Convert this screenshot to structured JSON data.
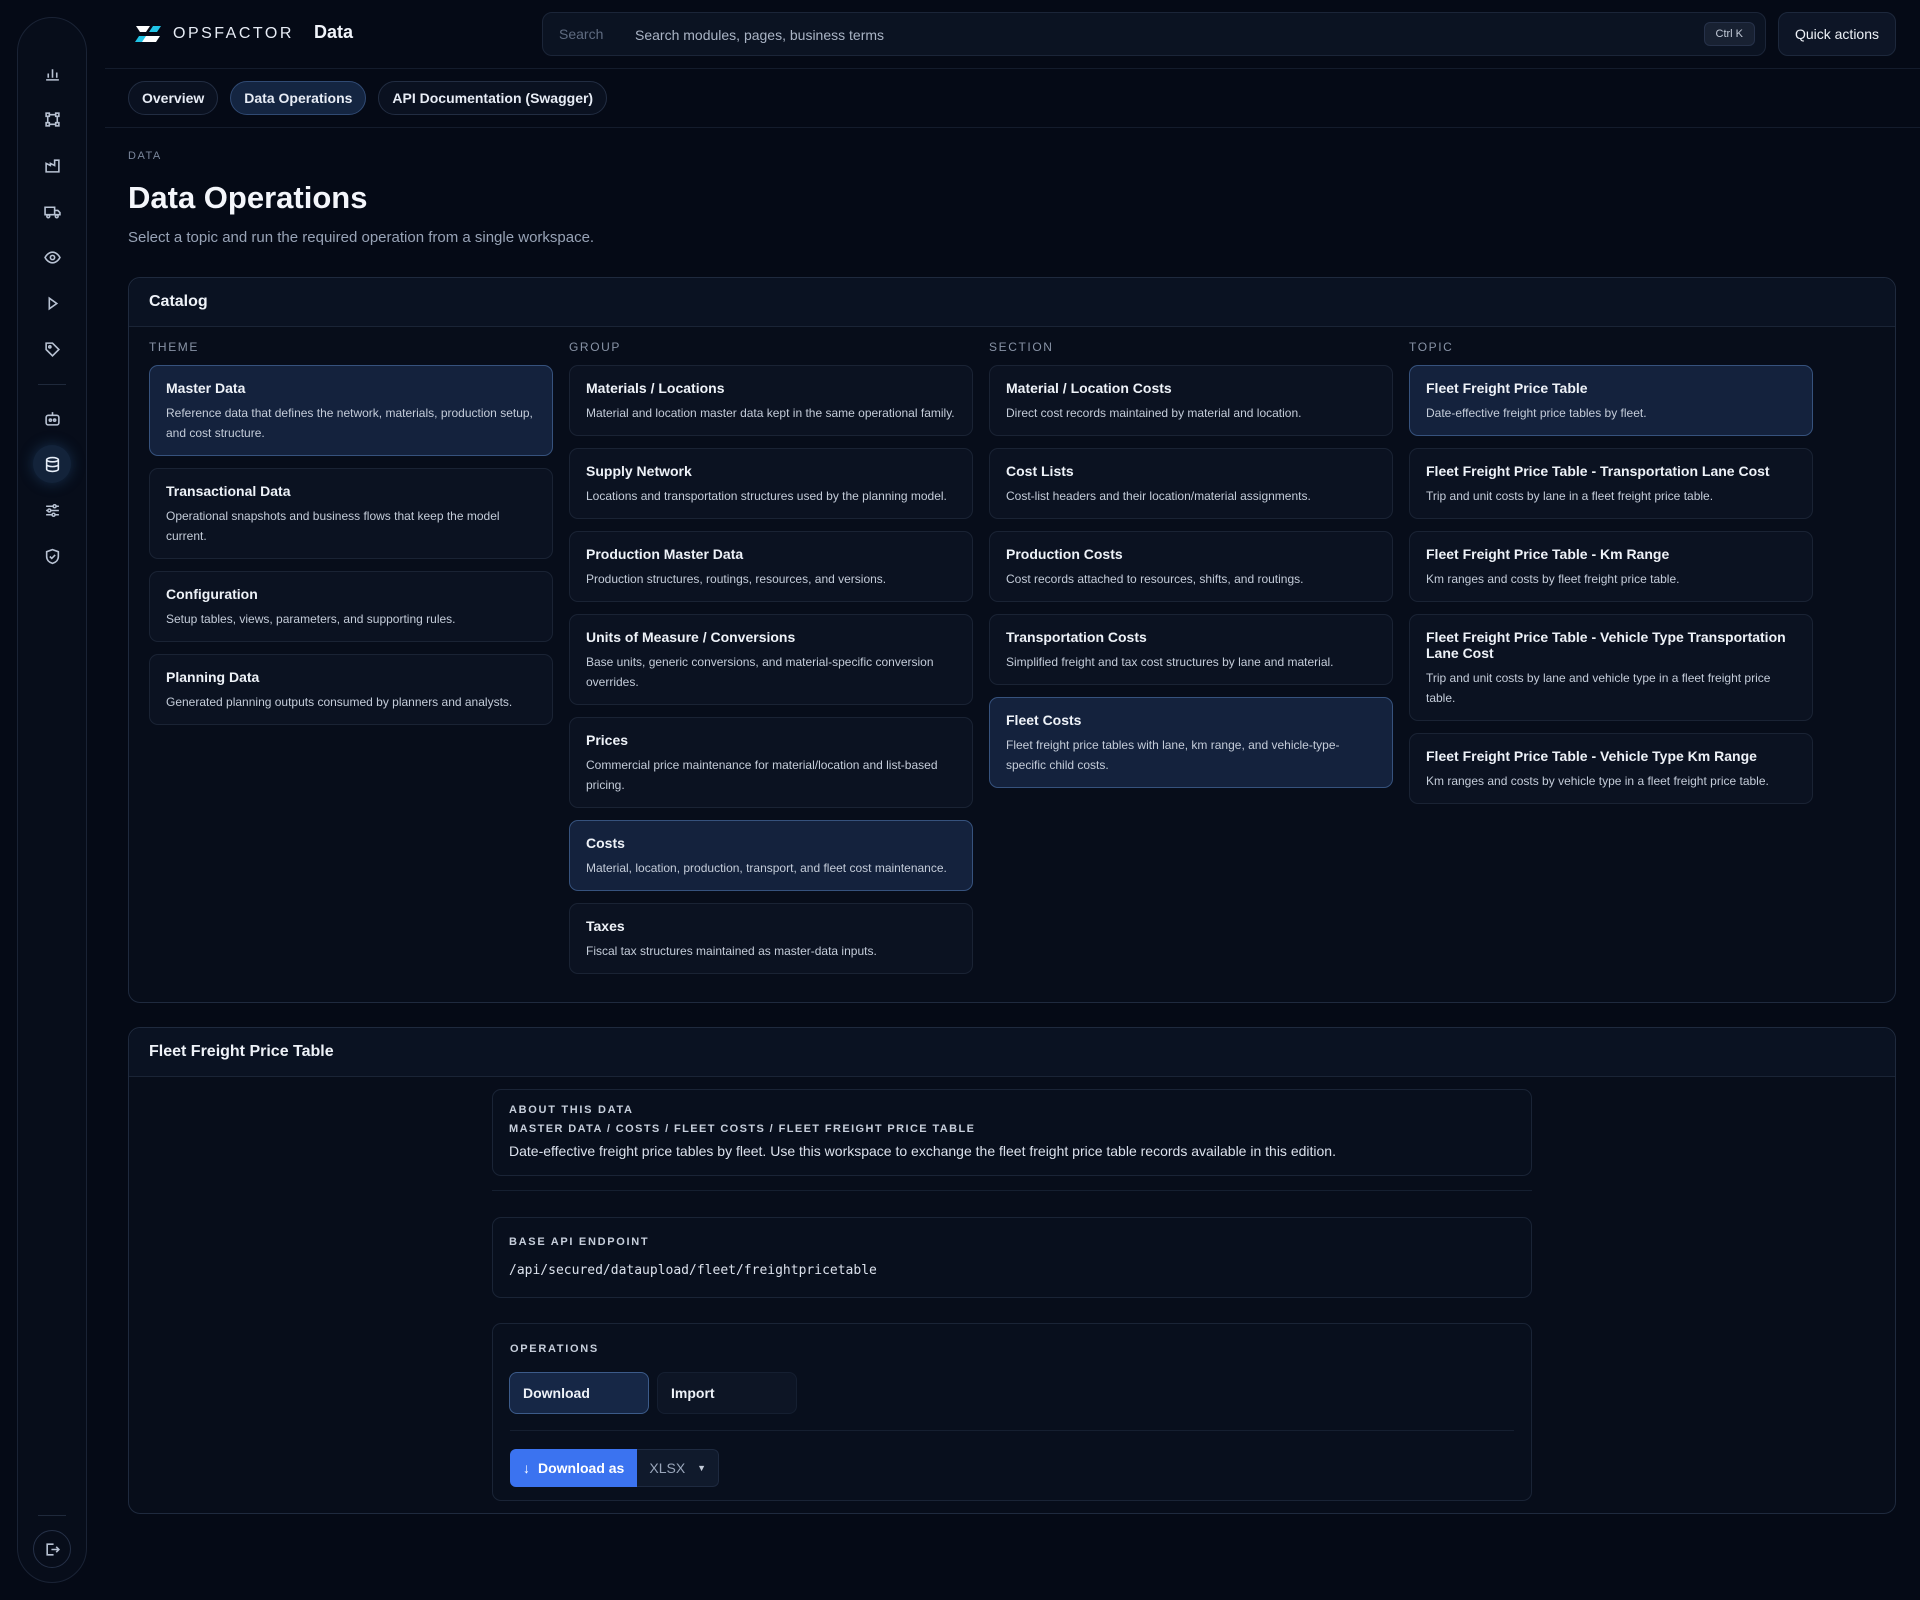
{
  "app": {
    "logo_text": "OPSFACTOR",
    "section": "Data",
    "search_label": "Search",
    "search_placeholder": "Search modules, pages, business terms",
    "search_shortcut": "Ctrl K",
    "quick_actions": "Quick actions"
  },
  "sidebar": {
    "icons": [
      "bar-chart-icon",
      "network-icon",
      "factory-icon",
      "truck-icon",
      "eye-icon",
      "play-icon",
      "tag-icon",
      "robot-icon",
      "database-icon",
      "sliders-icon",
      "shield-icon"
    ],
    "active": "database-icon",
    "footer_icon": "logout-icon"
  },
  "tabs": [
    "Overview",
    "Data Operations",
    "API Documentation (Swagger)"
  ],
  "active_tab": "Data Operations",
  "header": {
    "eyebrow": "DATA",
    "title": "Data Operations",
    "subtitle": "Select a topic and run the required operation from a single workspace."
  },
  "catalog": {
    "title": "Catalog",
    "columns": [
      {
        "heading": "THEME",
        "items": [
          {
            "title": "Master Data",
            "desc": "Reference data that defines the network, materials, production setup, and cost structure.",
            "active": true
          },
          {
            "title": "Transactional Data",
            "desc": "Operational snapshots and business flows that keep the model current.",
            "active": false
          },
          {
            "title": "Configuration",
            "desc": "Setup tables, views, parameters, and supporting rules.",
            "active": false
          },
          {
            "title": "Planning Data",
            "desc": "Generated planning outputs consumed by planners and analysts.",
            "active": false
          }
        ]
      },
      {
        "heading": "GROUP",
        "items": [
          {
            "title": "Materials / Locations",
            "desc": "Material and location master data kept in the same operational family.",
            "active": false
          },
          {
            "title": "Supply Network",
            "desc": "Locations and transportation structures used by the planning model.",
            "active": false
          },
          {
            "title": "Production Master Data",
            "desc": "Production structures, routings, resources, and versions.",
            "active": false
          },
          {
            "title": "Units of Measure / Conversions",
            "desc": "Base units, generic conversions, and material-specific conversion overrides.",
            "active": false
          },
          {
            "title": "Prices",
            "desc": "Commercial price maintenance for material/location and list-based pricing.",
            "active": false
          },
          {
            "title": "Costs",
            "desc": "Material, location, production, transport, and fleet cost maintenance.",
            "active": true
          },
          {
            "title": "Taxes",
            "desc": "Fiscal tax structures maintained as master-data inputs.",
            "active": false
          }
        ]
      },
      {
        "heading": "SECTION",
        "items": [
          {
            "title": "Material / Location Costs",
            "desc": "Direct cost records maintained by material and location.",
            "active": false
          },
          {
            "title": "Cost Lists",
            "desc": "Cost-list headers and their location/material assignments.",
            "active": false
          },
          {
            "title": "Production Costs",
            "desc": "Cost records attached to resources, shifts, and routings.",
            "active": false
          },
          {
            "title": "Transportation Costs",
            "desc": "Simplified freight and tax cost structures by lane and material.",
            "active": false
          },
          {
            "title": "Fleet Costs",
            "desc": "Fleet freight price tables with lane, km range, and vehicle-type-specific child costs.",
            "active": true
          }
        ]
      },
      {
        "heading": "TOPIC",
        "items": [
          {
            "title": "Fleet Freight Price Table",
            "desc": "Date-effective freight price tables by fleet.",
            "active": true
          },
          {
            "title": "Fleet Freight Price Table - Transportation Lane Cost",
            "desc": "Trip and unit costs by lane in a fleet freight price table.",
            "active": false
          },
          {
            "title": "Fleet Freight Price Table - Km Range",
            "desc": "Km ranges and costs by fleet freight price table.",
            "active": false
          },
          {
            "title": "Fleet Freight Price Table - Vehicle Type Transportation Lane Cost",
            "desc": "Trip and unit costs by lane and vehicle type in a fleet freight price table.",
            "active": false
          },
          {
            "title": "Fleet Freight Price Table - Vehicle Type Km Range",
            "desc": "Km ranges and costs by vehicle type in a fleet freight price table.",
            "active": false
          }
        ]
      }
    ]
  },
  "detail": {
    "title": "Fleet Freight Price Table",
    "about_label": "ABOUT THIS DATA",
    "breadcrumb": "MASTER DATA / COSTS / FLEET COSTS / FLEET FREIGHT PRICE TABLE",
    "about_text": "Date-effective freight price tables by fleet. Use this workspace to exchange the fleet freight price table records available in this edition.",
    "endpoint_label": "BASE API ENDPOINT",
    "endpoint": "/api/secured/dataupload/fleet/freightpricetable",
    "operations_label": "OPERATIONS",
    "operations": [
      "Download",
      "Import"
    ],
    "active_operation": "Download",
    "download_button": "Download as",
    "download_icon": "↓",
    "format_selected": "XLSX",
    "format_caret": "▼"
  },
  "colors": {
    "background": "#050a16",
    "accent": "#3b73f0",
    "active_card": "#14223d"
  }
}
